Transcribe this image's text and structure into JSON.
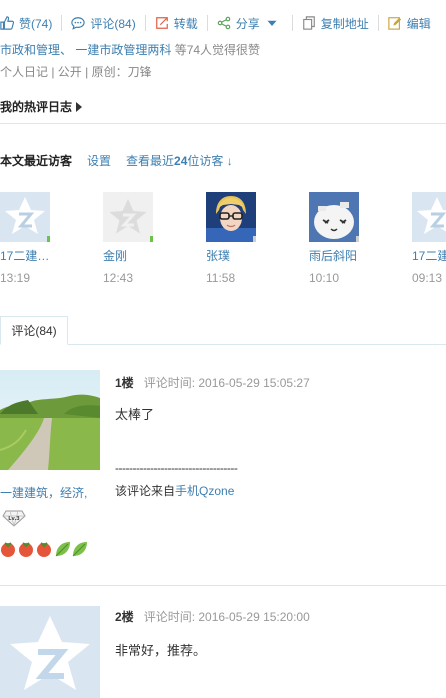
{
  "actions": {
    "like": "赞(74)",
    "comment": "评论(84)",
    "repost": "转载",
    "share": "分享",
    "copy": "复制地址",
    "edit": "编辑"
  },
  "likers": {
    "names": "市政和管理、 一建市政管理两科",
    "suffix": "等74人觉得很赞"
  },
  "meta": {
    "text": "个人日记 | 公开 | 原创：刀锋"
  },
  "hot": {
    "title": "我的热评日志"
  },
  "visitors": {
    "title": "本文最近访客",
    "settings": "设置",
    "view_prefix": "查看最近",
    "count": "24",
    "view_suffix": "位访客 ↓",
    "items": [
      {
        "name": "17二建…",
        "time": "13:19",
        "online": true,
        "avatar": "default-qzone-avatar"
      },
      {
        "name": "金刚",
        "time": "12:43",
        "online": true,
        "avatar": "grey-star-avatar"
      },
      {
        "name": "张璞",
        "time": "11:58",
        "online": false,
        "avatar": "photo-person-glasses"
      },
      {
        "name": "雨后斜阳",
        "time": "10:10",
        "online": false,
        "avatar": "cartoon-face-avatar"
      },
      {
        "name": "17二建",
        "time": "09:13",
        "online": false,
        "avatar": "default-qzone-avatar"
      }
    ]
  },
  "tab": {
    "label": "评论(84)"
  },
  "comments": [
    {
      "floor": "1楼",
      "time": "评论时间: 2016-05-29 15:05:27",
      "text": "太棒了",
      "divider": "-----------------------------------",
      "source_prefix": "该评论来自",
      "source_link": "手机Qzone",
      "author": "一建建筑，经济,",
      "badge": "Lv.3"
    },
    {
      "floor": "2楼",
      "time": "评论时间: 2016-05-29 15:20:00",
      "text": "非常好，推荐。"
    }
  ],
  "colors": {
    "link": "#3e7fb0",
    "online": "#6cc24a",
    "divider": "#d8e8ee"
  }
}
